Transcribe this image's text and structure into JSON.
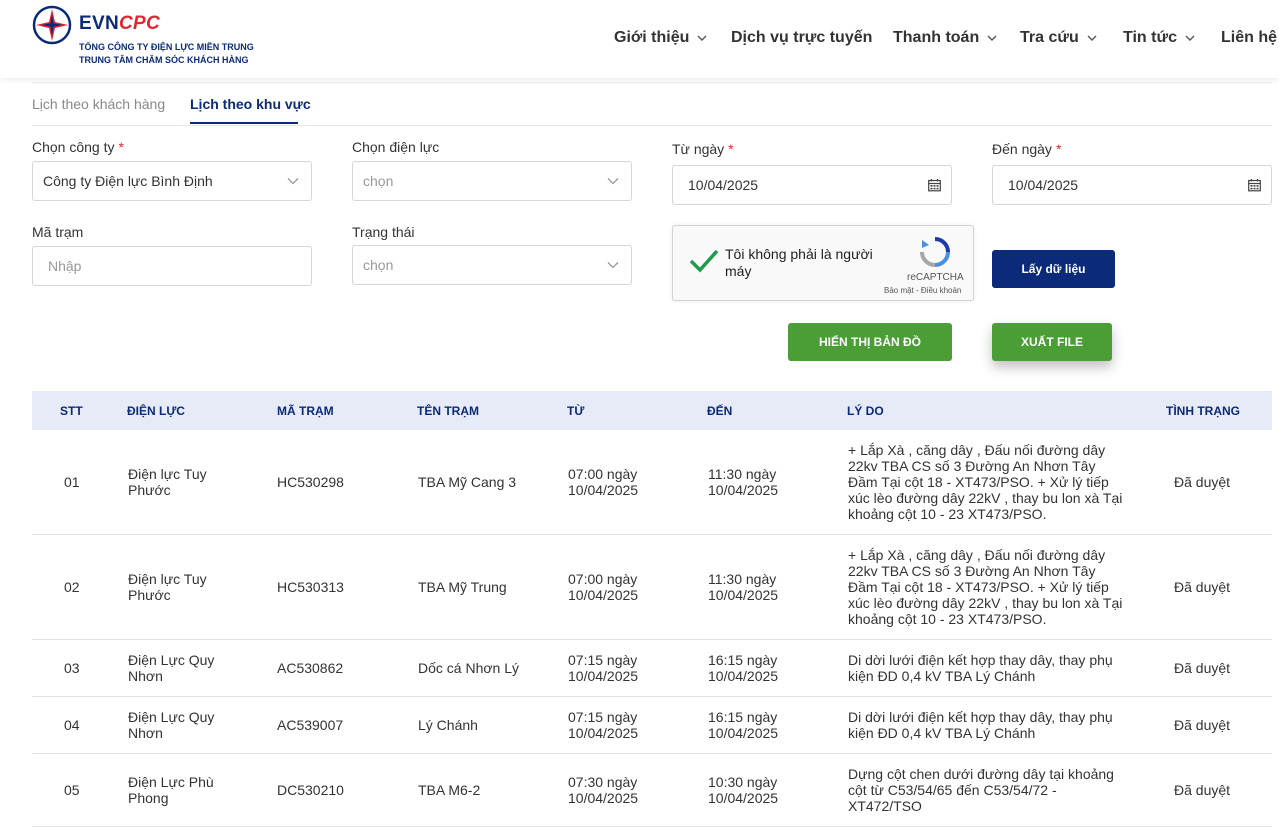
{
  "header": {
    "brand_evn": "EVN",
    "brand_cpc": "CPC",
    "company_line1": "TỔNG CÔNG TY ĐIỆN LỰC MIỀN TRUNG",
    "company_line2": "TRUNG TÂM CHĂM SÓC KHÁCH HÀNG",
    "nav": [
      {
        "label": "Giới thiệu",
        "has_dropdown": true
      },
      {
        "label": "Dịch vụ trực tuyến",
        "has_dropdown": false
      },
      {
        "label": "Thanh toán",
        "has_dropdown": true
      },
      {
        "label": "Tra cứu",
        "has_dropdown": true
      },
      {
        "label": "Tin tức",
        "has_dropdown": true
      },
      {
        "label": "Liên hệ",
        "has_dropdown": false
      }
    ]
  },
  "tabs": [
    {
      "label": "Lịch theo khách hàng",
      "active": false
    },
    {
      "label": "Lịch theo khu vực",
      "active": true
    }
  ],
  "form": {
    "company": {
      "label": "Chọn công ty",
      "required_mark": "*",
      "value": "Công ty Điện lực Bình Định"
    },
    "branch": {
      "label": "Chọn điện lực",
      "placeholder": "chọn"
    },
    "from_date": {
      "label": "Từ ngày",
      "required_mark": "*",
      "value": "10/04/2025"
    },
    "to_date": {
      "label": "Đến ngày",
      "required_mark": "*",
      "value": "10/04/2025"
    },
    "station": {
      "label": "Mã trạm",
      "placeholder": "Nhập"
    },
    "status": {
      "label": "Trạng thái",
      "placeholder": "chọn"
    },
    "captcha": {
      "text": "Tôi không phải là người máy",
      "brand": "reCAPTCHA",
      "links": "Bảo mật - Điều khoản"
    },
    "buttons": {
      "fetch": "Lấy dữ liệu",
      "show_map": "HIỂN THỊ BẢN ĐỒ",
      "export": "XUẤT FILE"
    }
  },
  "colors": {
    "primary": "#0b2a7a",
    "accent_red": "#e4252e",
    "green": "#4a9e35",
    "table_header_bg": "#e6ebf7"
  },
  "table": {
    "headers": [
      "STT",
      "ĐIỆN LỰC",
      "MÃ TRẠM",
      "TÊN TRẠM",
      "TỪ",
      "ĐẾN",
      "LÝ DO",
      "TÌNH TRẠNG"
    ],
    "rows": [
      {
        "stt": "01",
        "dien_luc": "Điện lực Tuy Phước",
        "ma_tram": "HC530298",
        "ten_tram": "TBA Mỹ Cang 3",
        "tu": "07:00 ngày 10/04/2025",
        "den": "11:30 ngày 10/04/2025",
        "ly_do": "+ Lắp Xà , căng dây , Đấu nối đường dây 22kv TBA CS số 3 Đường An Nhơn Tây Đầm Tại cột 18 - XT473/PSO. + Xử lý tiếp xúc lèo đường dây 22kV , thay bu lon xà Tại khoảng cột 10 - 23 XT473/PSO.",
        "tinh_trang": "Đã duyệt"
      },
      {
        "stt": "02",
        "dien_luc": "Điện lực Tuy Phước",
        "ma_tram": "HC530313",
        "ten_tram": "TBA Mỹ Trung",
        "tu": "07:00 ngày 10/04/2025",
        "den": "11:30 ngày 10/04/2025",
        "ly_do": "+ Lắp Xà , căng dây , Đấu nối đường dây 22kv TBA CS số 3 Đường An Nhơn Tây Đầm Tại cột 18 - XT473/PSO. + Xử lý tiếp xúc lèo đường dây 22kV , thay bu lon xà Tại khoảng cột 10 - 23 XT473/PSO.",
        "tinh_trang": "Đã duyệt"
      },
      {
        "stt": "03",
        "dien_luc": "Điện Lực Quy Nhơn",
        "ma_tram": "AC530862",
        "ten_tram": "Dốc cá Nhơn Lý",
        "tu": "07:15 ngày 10/04/2025",
        "den": "16:15 ngày 10/04/2025",
        "ly_do": "Di dời lưới điện kết hợp thay dây, thay phụ kiện ĐD 0,4 kV TBA Lý Chánh",
        "tinh_trang": "Đã duyệt"
      },
      {
        "stt": "04",
        "dien_luc": "Điện Lực Quy Nhơn",
        "ma_tram": "AC539007",
        "ten_tram": "Lý Chánh",
        "tu": "07:15 ngày 10/04/2025",
        "den": "16:15 ngày 10/04/2025",
        "ly_do": "Di dời lưới điện kết hợp thay dây, thay phụ kiện ĐD 0,4 kV TBA Lý Chánh",
        "tinh_trang": "Đã duyệt"
      },
      {
        "stt": "05",
        "dien_luc": "Điện Lực Phù Phong",
        "ma_tram": "DC530210",
        "ten_tram": "TBA M6-2",
        "tu": "07:30 ngày 10/04/2025",
        "den": "10:30 ngày 10/04/2025",
        "ly_do": "Dựng cột chen dưới đường dây tại khoảng cột từ C53/54/65 đến C53/54/72 - XT472/TSO",
        "tinh_trang": "Đã duyệt"
      }
    ]
  }
}
